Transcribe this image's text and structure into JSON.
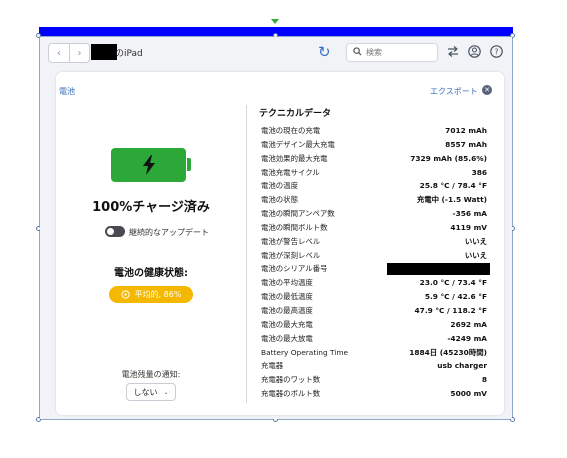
{
  "toolbar": {
    "device_name": "のiPad",
    "search_placeholder": "検索"
  },
  "panel": {
    "title": "電池",
    "export_label": "エクスポート"
  },
  "battery": {
    "charge_status": "100%チャージ済み",
    "continuous_update_label": "継続的なアップデート",
    "continuous_update_on": false,
    "health_title": "電池の健康状態:",
    "health_badge": "平均的, 86%",
    "notify_label": "電池残量の通知:",
    "notify_value": "しない"
  },
  "technical": {
    "title": "テクニカルデータ",
    "rows": [
      {
        "label": "電池の現在の充電",
        "value": "7012 mAh"
      },
      {
        "label": "電池デザイン最大充電",
        "value": "8557 mAh"
      },
      {
        "label": "電池効果的最大充電",
        "value": "7329 mAh (85.6%)"
      },
      {
        "label": "電池充電サイクル",
        "value": "386"
      },
      {
        "label": "電池の温度",
        "value": "25.8 °C / 78.4 °F"
      },
      {
        "label": "電池の状態",
        "value": "充電中 (-1.5 Watt)"
      },
      {
        "label": "電池の瞬間アンペア数",
        "value": "-356 mA"
      },
      {
        "label": "電池の瞬間ボルト数",
        "value": "4119 mV"
      },
      {
        "label": "電池が警告レベル",
        "value": "いいえ"
      },
      {
        "label": "電池が深刻レベル",
        "value": "いいえ"
      },
      {
        "label": "電池のシリアル番号",
        "value": "",
        "redacted": true
      },
      {
        "label": "電池の平均温度",
        "value": "23.0 °C / 73.4 °F"
      },
      {
        "label": "電池の最低温度",
        "value": "5.9 °C / 42.6 °F"
      },
      {
        "label": "電池の最高温度",
        "value": "47.9 °C / 118.2 °F"
      },
      {
        "label": "電池の最大充電",
        "value": "2692 mA"
      },
      {
        "label": "電池の最大放電",
        "value": "-4249 mA"
      },
      {
        "label": "Battery Operating Time",
        "value": "1884日 (45230時間)"
      },
      {
        "label": "充電器",
        "value": "usb charger"
      },
      {
        "label": "充電器のワット数",
        "value": "8"
      },
      {
        "label": "充電器のボルト数",
        "value": "5000 mV"
      }
    ]
  },
  "colors": {
    "selection_bar": "#0000ff",
    "battery_green": "#2ba838",
    "health_badge": "#f5b800",
    "link_blue": "#3a6fb8"
  }
}
